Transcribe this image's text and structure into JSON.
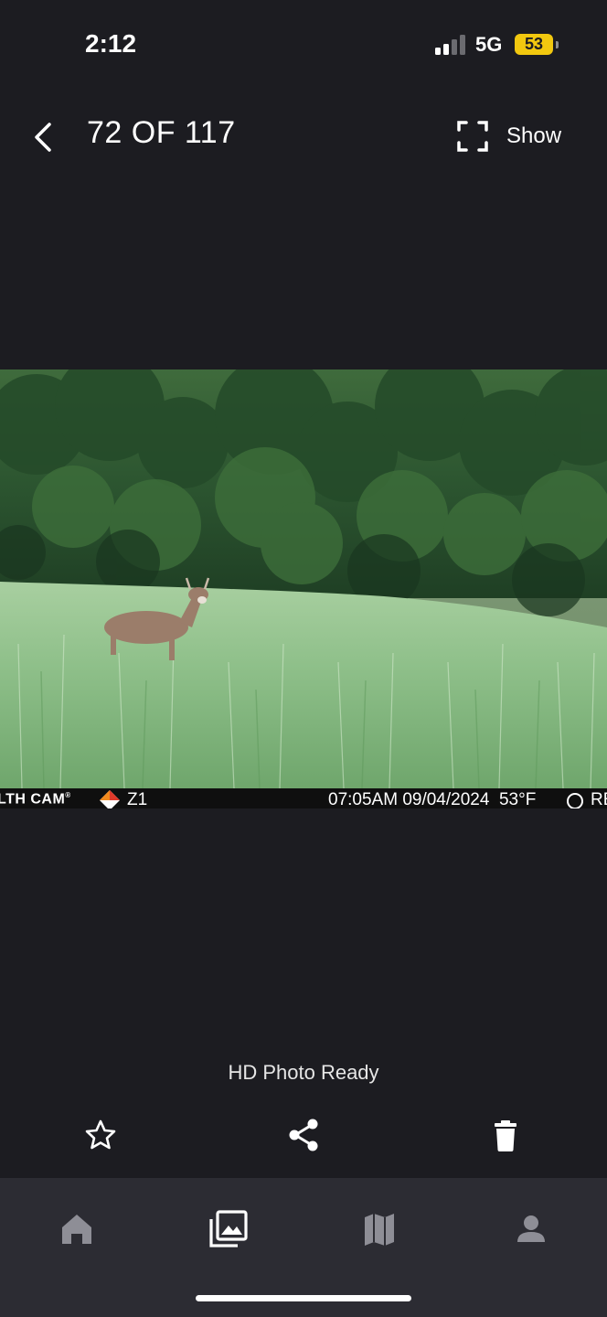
{
  "status_bar": {
    "time": "2:12",
    "network": "5G",
    "battery": "53",
    "battery_color": "#f2c80f"
  },
  "nav": {
    "back_icon": "chevron-left-icon",
    "counter": "72 OF 117",
    "show_label": "Show",
    "show_icon": "fullscreen-icon"
  },
  "photo": {
    "stamp": {
      "brand": "LTH CAM",
      "trademark": "®",
      "model": "Z1",
      "time": "07:05AM",
      "date": "09/04/2024",
      "temperature": "53°F",
      "suffix": "RE"
    }
  },
  "hd_status": "HD Photo Ready",
  "actions": {
    "favorite_icon": "star-icon",
    "share_icon": "share-icon",
    "delete_icon": "trash-icon"
  },
  "tab_bar": {
    "items": [
      {
        "icon": "home-icon",
        "active": false
      },
      {
        "icon": "gallery-icon",
        "active": true
      },
      {
        "icon": "map-icon",
        "active": false
      },
      {
        "icon": "profile-icon",
        "active": false
      }
    ]
  }
}
